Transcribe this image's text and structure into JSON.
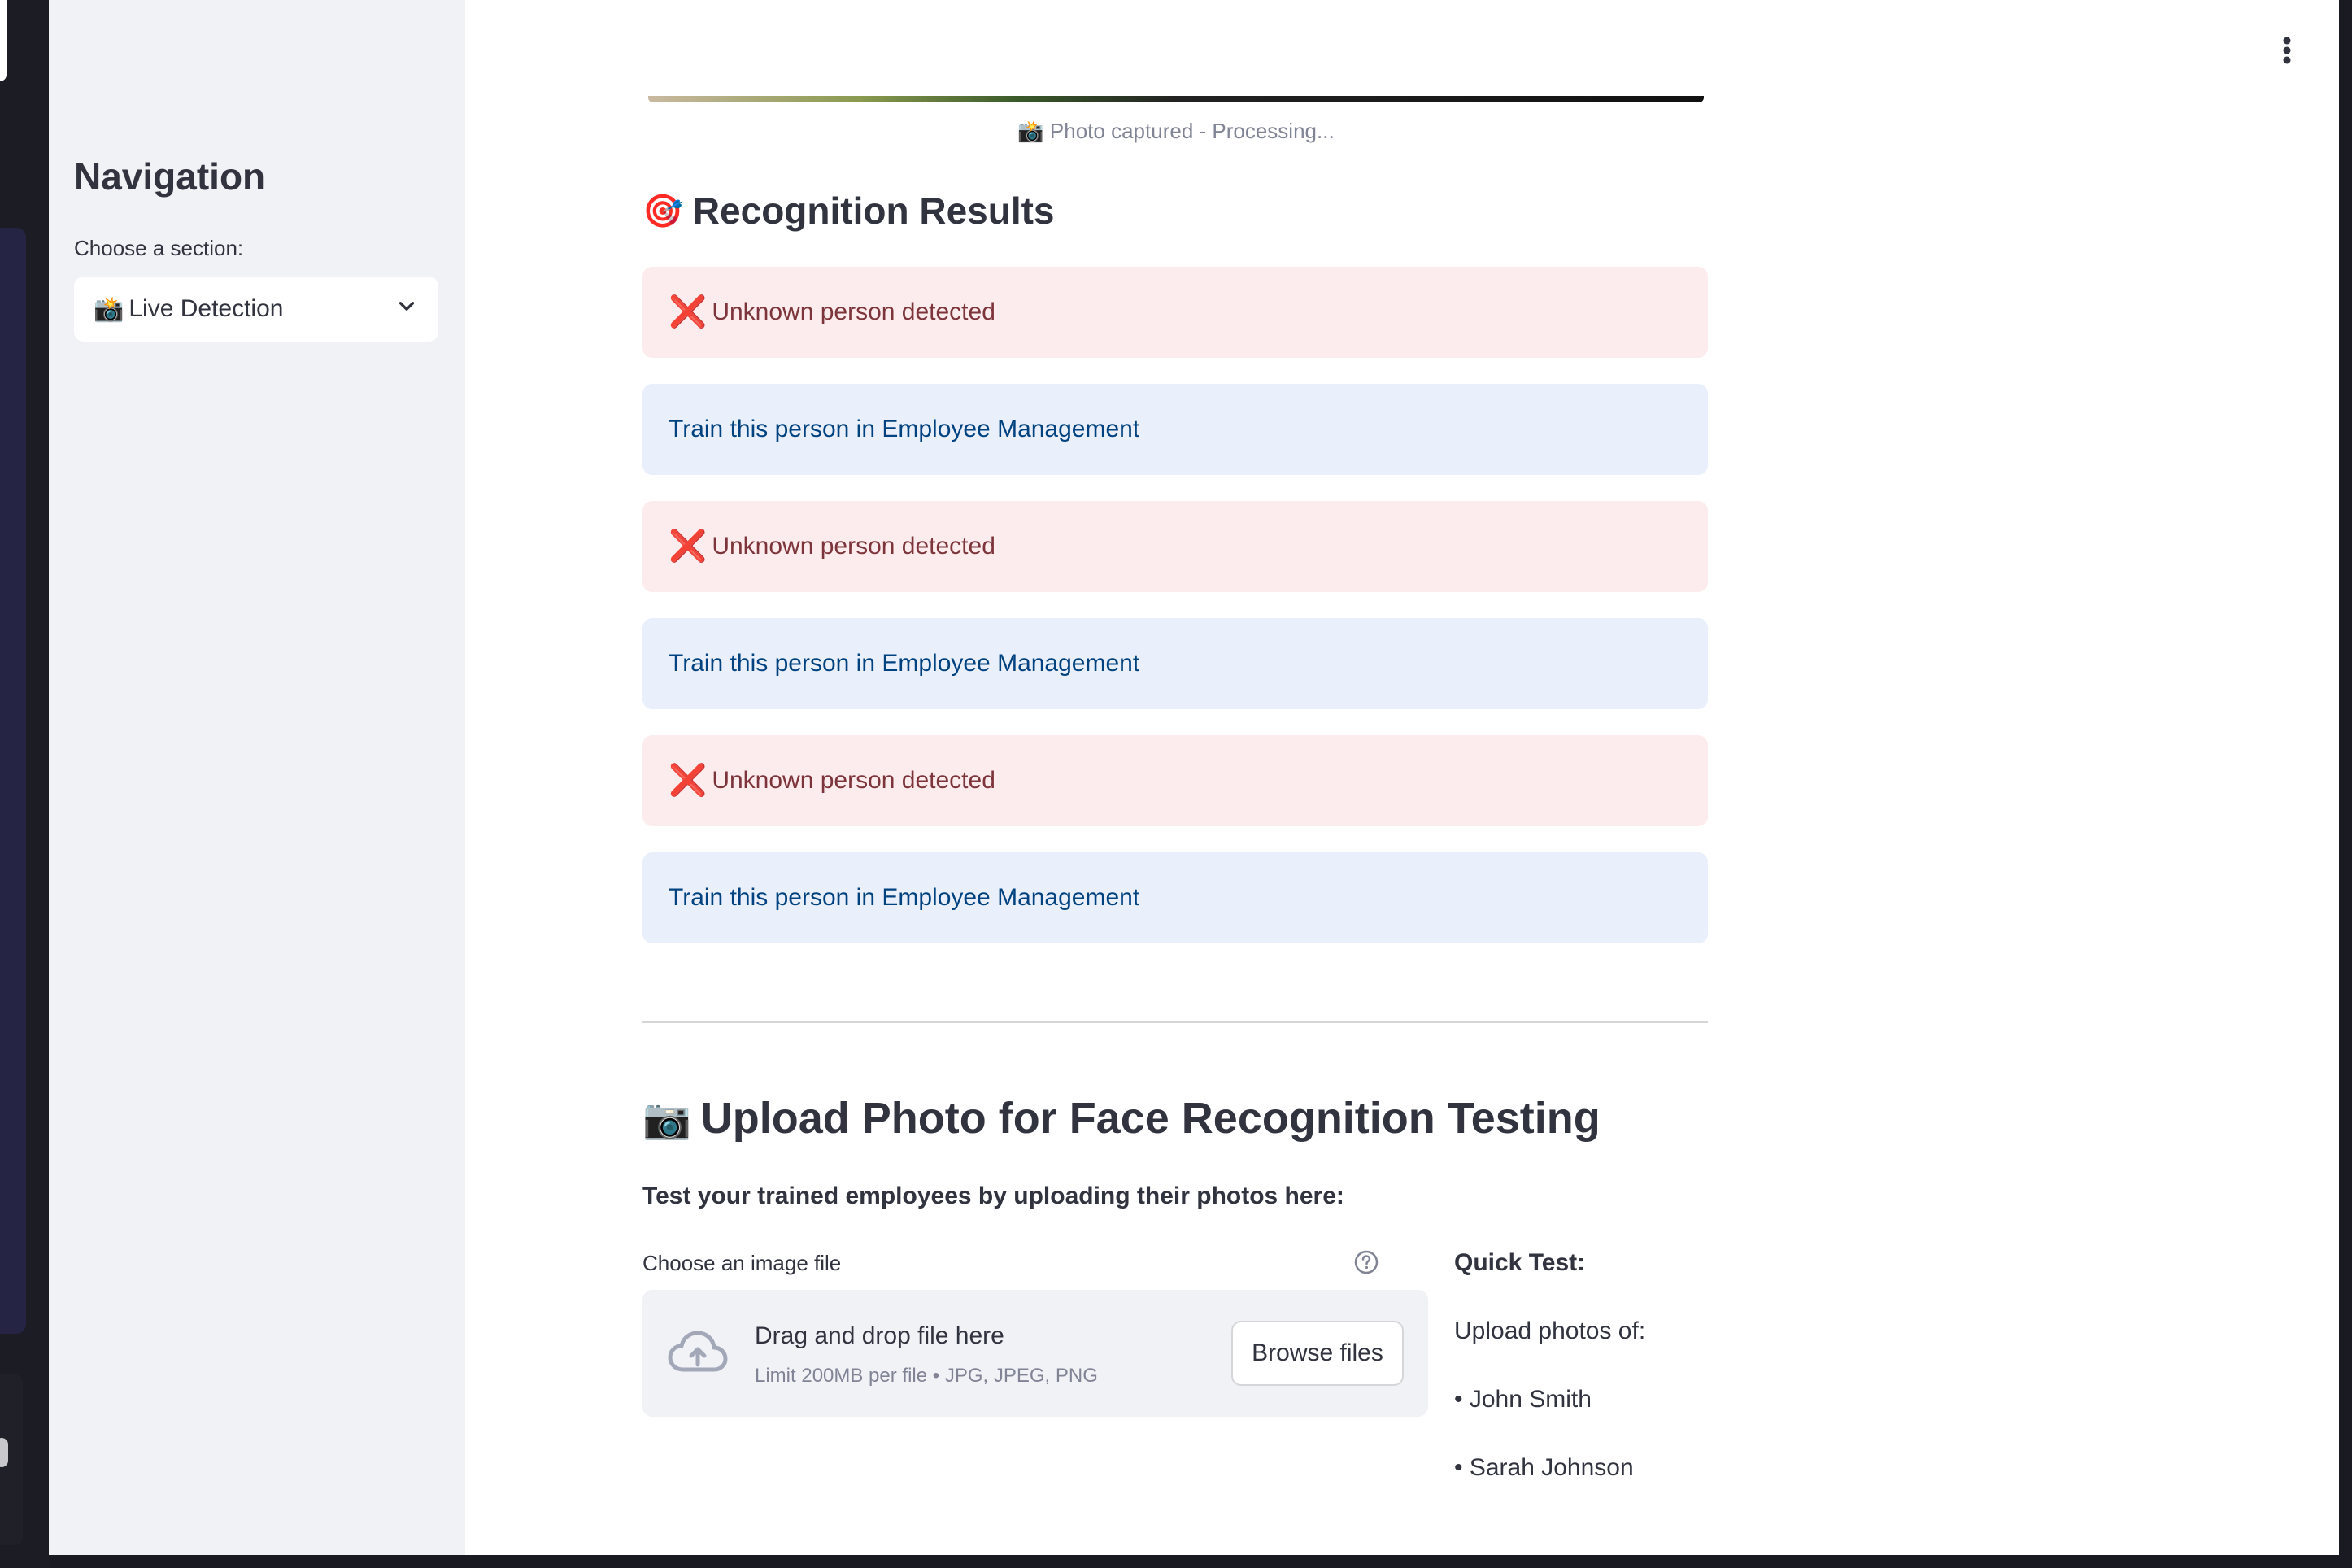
{
  "sidebar": {
    "title": "Navigation",
    "select_label": "Choose a section:",
    "select_emoji": "📸",
    "select_value": "Live Detection"
  },
  "main": {
    "photo_caption": "📸 Photo captured - Processing...",
    "results_emoji": "🎯",
    "results_title": "Recognition Results",
    "alerts": [
      {
        "type": "error",
        "icon": "❌",
        "text": "Unknown person detected"
      },
      {
        "type": "info",
        "text": "Train this person in Employee Management"
      },
      {
        "type": "error",
        "icon": "❌",
        "text": "Unknown person detected"
      },
      {
        "type": "info",
        "text": "Train this person in Employee Management"
      },
      {
        "type": "error",
        "icon": "❌",
        "text": "Unknown person detected"
      },
      {
        "type": "info",
        "text": "Train this person in Employee Management"
      }
    ],
    "upload_emoji": "📷",
    "upload_title": "Upload Photo for Face Recognition Testing",
    "upload_subtitle": "Test your trained employees by uploading their photos here:",
    "file_label": "Choose an image file",
    "dropzone_main": "Drag and drop file here",
    "dropzone_sub": "Limit 200MB per file • JPG, JPEG, PNG",
    "browse_label": "Browse files",
    "quick_test": {
      "title": "Quick Test:",
      "intro": "Upload photos of:",
      "names": [
        "• John Smith",
        "• Sarah Johnson"
      ]
    }
  },
  "colors": {
    "sidebar_bg": "#f0f2f6",
    "error_bg": "#fdeced",
    "error_text": "#7d353b",
    "info_bg": "#e9f0fb",
    "info_text": "#004280",
    "error_icon": "#e02f2f"
  }
}
